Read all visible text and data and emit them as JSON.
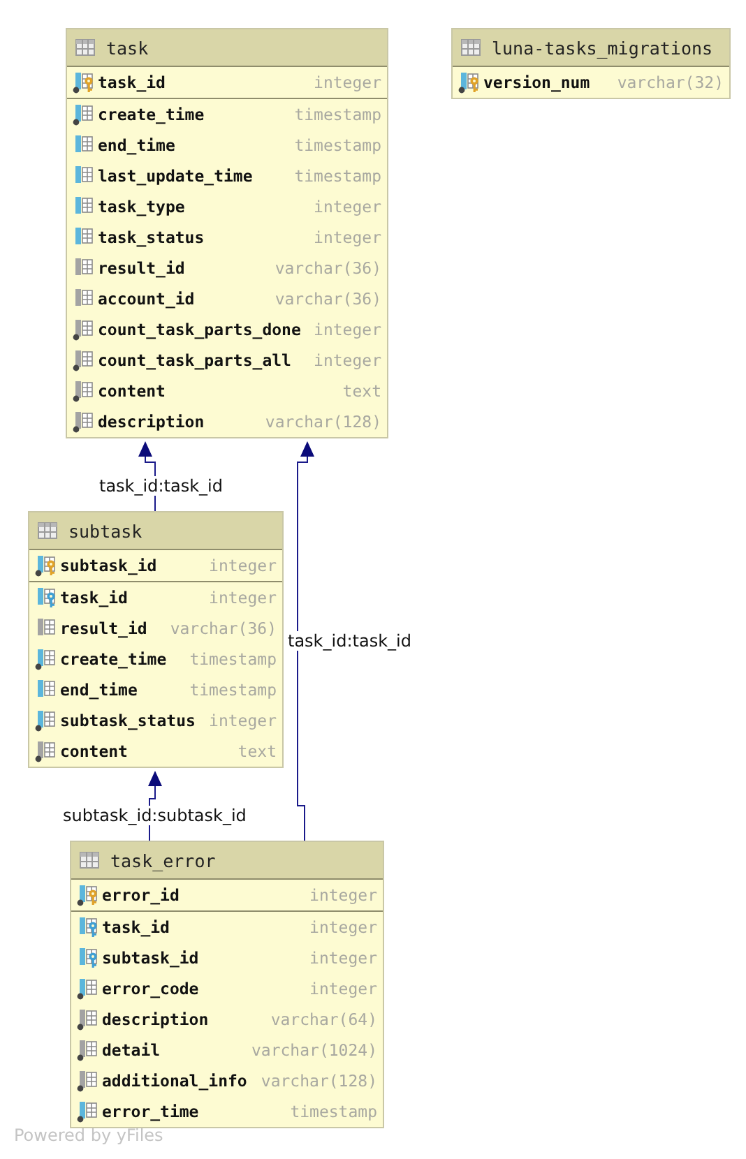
{
  "tables": [
    {
      "name": "task",
      "columns": [
        {
          "name": "task_id",
          "type": "integer",
          "kind": "pk",
          "not_null": true,
          "indexed": true
        },
        {
          "name": "create_time",
          "type": "timestamp",
          "kind": "column",
          "not_null": true,
          "indexed": true
        },
        {
          "name": "end_time",
          "type": "timestamp",
          "kind": "column",
          "not_null": false,
          "indexed": true
        },
        {
          "name": "last_update_time",
          "type": "timestamp",
          "kind": "column",
          "not_null": false,
          "indexed": true
        },
        {
          "name": "task_type",
          "type": "integer",
          "kind": "column",
          "not_null": false,
          "indexed": true
        },
        {
          "name": "task_status",
          "type": "integer",
          "kind": "column",
          "not_null": false,
          "indexed": true
        },
        {
          "name": "result_id",
          "type": "varchar(36)",
          "kind": "column",
          "not_null": false,
          "indexed": false
        },
        {
          "name": "account_id",
          "type": "varchar(36)",
          "kind": "column",
          "not_null": false,
          "indexed": false
        },
        {
          "name": "count_task_parts_done",
          "type": "integer",
          "kind": "column",
          "not_null": true,
          "indexed": false
        },
        {
          "name": "count_task_parts_all",
          "type": "integer",
          "kind": "column",
          "not_null": true,
          "indexed": false
        },
        {
          "name": "content",
          "type": "text",
          "kind": "column",
          "not_null": true,
          "indexed": false
        },
        {
          "name": "description",
          "type": "varchar(128)",
          "kind": "column",
          "not_null": true,
          "indexed": false
        }
      ]
    },
    {
      "name": "luna-tasks_migrations",
      "columns": [
        {
          "name": "version_num",
          "type": "varchar(32)",
          "kind": "pk",
          "not_null": true,
          "indexed": true
        }
      ]
    },
    {
      "name": "subtask",
      "columns": [
        {
          "name": "subtask_id",
          "type": "integer",
          "kind": "pk",
          "not_null": true,
          "indexed": true
        },
        {
          "name": "task_id",
          "type": "integer",
          "kind": "fk",
          "not_null": false,
          "indexed": true
        },
        {
          "name": "result_id",
          "type": "varchar(36)",
          "kind": "column",
          "not_null": false,
          "indexed": false
        },
        {
          "name": "create_time",
          "type": "timestamp",
          "kind": "column",
          "not_null": true,
          "indexed": true
        },
        {
          "name": "end_time",
          "type": "timestamp",
          "kind": "column",
          "not_null": false,
          "indexed": true
        },
        {
          "name": "subtask_status",
          "type": "integer",
          "kind": "column",
          "not_null": true,
          "indexed": true
        },
        {
          "name": "content",
          "type": "text",
          "kind": "column",
          "not_null": true,
          "indexed": false
        }
      ]
    },
    {
      "name": "task_error",
      "columns": [
        {
          "name": "error_id",
          "type": "integer",
          "kind": "pk",
          "not_null": true,
          "indexed": true
        },
        {
          "name": "task_id",
          "type": "integer",
          "kind": "fk",
          "not_null": false,
          "indexed": true
        },
        {
          "name": "subtask_id",
          "type": "integer",
          "kind": "fk",
          "not_null": false,
          "indexed": true
        },
        {
          "name": "error_code",
          "type": "integer",
          "kind": "column",
          "not_null": true,
          "indexed": true
        },
        {
          "name": "description",
          "type": "varchar(64)",
          "kind": "column",
          "not_null": true,
          "indexed": false
        },
        {
          "name": "detail",
          "type": "varchar(1024)",
          "kind": "column",
          "not_null": true,
          "indexed": false
        },
        {
          "name": "additional_info",
          "type": "varchar(128)",
          "kind": "column",
          "not_null": true,
          "indexed": false
        },
        {
          "name": "error_time",
          "type": "timestamp",
          "kind": "column",
          "not_null": true,
          "indexed": true
        }
      ]
    }
  ],
  "relations": [
    {
      "label": "task_id:task_id"
    },
    {
      "label": "task_id:task_id"
    },
    {
      "label": "subtask_id:subtask_id"
    }
  ],
  "footer": "Powered by yFiles"
}
